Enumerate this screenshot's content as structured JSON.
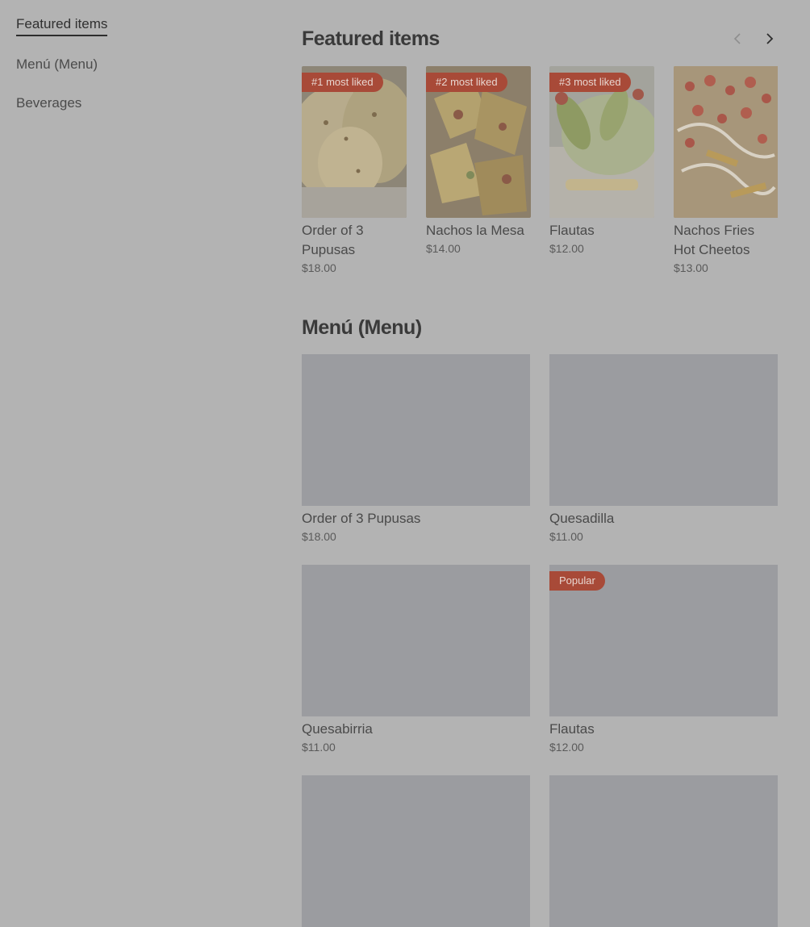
{
  "sidebar": {
    "items": [
      {
        "label": "Featured items",
        "active": true
      },
      {
        "label": "Menú (Menu)",
        "active": false
      },
      {
        "label": "Beverages",
        "active": false
      }
    ]
  },
  "featured": {
    "title": "Featured items",
    "prev_icon": "chevron-left-icon",
    "next_icon": "chevron-right-icon",
    "items": [
      {
        "badge": "#1 most liked",
        "name": "Order of 3 Pupusas",
        "price": "$18.00"
      },
      {
        "badge": "#2 most liked",
        "name": "Nachos la Mesa",
        "price": "$14.00"
      },
      {
        "badge": "#3 most liked",
        "name": "Flautas",
        "price": "$12.00"
      },
      {
        "badge": "",
        "name": "Nachos Fries Hot Cheetos",
        "price": "$13.00"
      }
    ]
  },
  "menu": {
    "title": "Menú (Menu)",
    "items": [
      {
        "name": "Order of 3 Pupusas",
        "price": "$18.00",
        "badge": ""
      },
      {
        "name": "Quesadilla",
        "price": "$11.00",
        "badge": ""
      },
      {
        "name": "Quesabirria",
        "price": "$11.00",
        "badge": ""
      },
      {
        "name": "Flautas",
        "price": "$12.00",
        "badge": "Popular"
      },
      {
        "name": "",
        "price": "",
        "badge": ""
      },
      {
        "name": "",
        "price": "",
        "badge": ""
      }
    ]
  },
  "colors": {
    "overlay_background": "#b3b3b3",
    "badge": "#a84a38",
    "placeholder_image": "#9b9ca0"
  }
}
